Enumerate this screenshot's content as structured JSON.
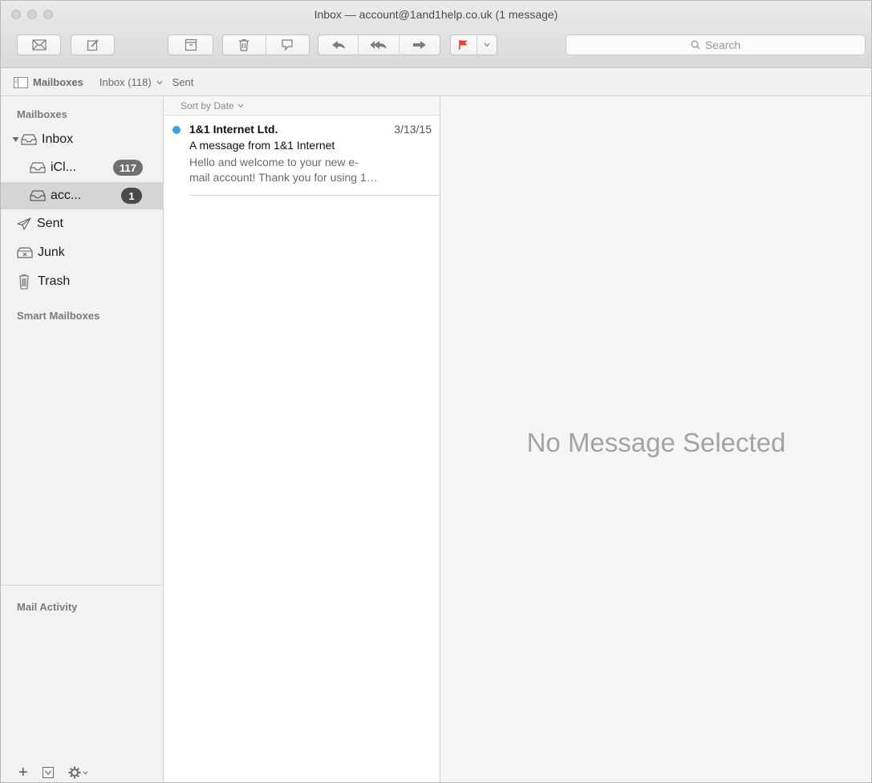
{
  "window": {
    "title": "Inbox — account@1and1help.co.uk (1 message)"
  },
  "toolbar": {
    "search_placeholder": "Search",
    "icons": [
      "get-mail-icon",
      "compose-icon",
      "archive-icon",
      "trash-icon",
      "junk-icon",
      "reply-icon",
      "reply-all-icon",
      "forward-icon",
      "flag-icon",
      "chevron-down-icon",
      "search-icon"
    ],
    "flag_color": "#e8423f"
  },
  "favorites_bar": {
    "mailboxes_label": "Mailboxes",
    "inbox_label": "Inbox (118)",
    "sent_label": "Sent"
  },
  "sidebar": {
    "mailboxes_header": "Mailboxes",
    "items": [
      {
        "label": "Inbox",
        "icon": "inbox-icon"
      },
      {
        "label": "iCl...",
        "icon": "inbox-icon",
        "badge": "117"
      },
      {
        "label": "acc...",
        "icon": "inbox-icon",
        "badge": "1"
      },
      {
        "label": "Sent",
        "icon": "paper-plane-icon"
      },
      {
        "label": "Junk",
        "icon": "junk-bin-icon"
      },
      {
        "label": "Trash",
        "icon": "trash-icon"
      }
    ],
    "smart_mailboxes_header": "Smart Mailboxes",
    "mail_activity_header": "Mail Activity",
    "footer": {
      "add": "+",
      "gear_icon": "gear-icon"
    }
  },
  "message_list": {
    "sort_label": "Sort by Date",
    "messages": [
      {
        "from": "1&1 Internet Ltd.",
        "date": "3/13/15",
        "subject": "A message from 1&1 Internet",
        "preview": "Hello and welcome to your new e-mail account! Thank you for using 1…",
        "preview_line1": "Hello and welcome to your new e-",
        "preview_line2": "mail account! Thank you for using 1…",
        "unread": true
      }
    ]
  },
  "preview_pane": {
    "empty_text": "No Message Selected"
  },
  "colors": {
    "unread_dot": "#3aa0ea",
    "badge_bg": "#707070",
    "selected_row": "#d5d5d5"
  }
}
